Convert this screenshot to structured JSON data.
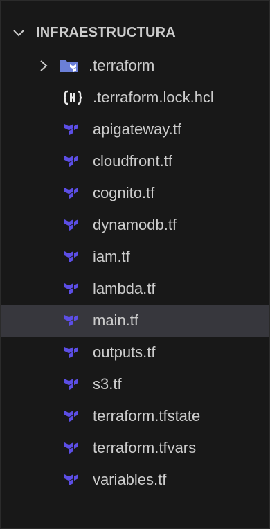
{
  "explorer": {
    "root_folder": "INFRAESTRUCTURA",
    "items": [
      {
        "label": ".terraform",
        "type": "folder",
        "icon": "folder-terraform-icon"
      },
      {
        "label": ".terraform.lock.hcl",
        "type": "file",
        "icon": "hcl-lock-icon"
      },
      {
        "label": "apigateway.tf",
        "type": "file",
        "icon": "terraform-icon"
      },
      {
        "label": "cloudfront.tf",
        "type": "file",
        "icon": "terraform-icon"
      },
      {
        "label": "cognito.tf",
        "type": "file",
        "icon": "terraform-icon"
      },
      {
        "label": "dynamodb.tf",
        "type": "file",
        "icon": "terraform-icon"
      },
      {
        "label": "iam.tf",
        "type": "file",
        "icon": "terraform-icon"
      },
      {
        "label": "lambda.tf",
        "type": "file",
        "icon": "terraform-icon"
      },
      {
        "label": "main.tf",
        "type": "file",
        "icon": "terraform-icon",
        "selected": true
      },
      {
        "label": "outputs.tf",
        "type": "file",
        "icon": "terraform-icon"
      },
      {
        "label": "s3.tf",
        "type": "file",
        "icon": "terraform-icon"
      },
      {
        "label": "terraform.tfstate",
        "type": "file",
        "icon": "terraform-icon"
      },
      {
        "label": "terraform.tfvars",
        "type": "file",
        "icon": "terraform-icon"
      },
      {
        "label": "variables.tf",
        "type": "file",
        "icon": "terraform-icon"
      }
    ]
  },
  "colors": {
    "background": "#181818",
    "text": "#cccccc",
    "selection": "#37373d",
    "terraform_icon": "#5c4ee5",
    "folder_icon": "#6b7fd7"
  }
}
